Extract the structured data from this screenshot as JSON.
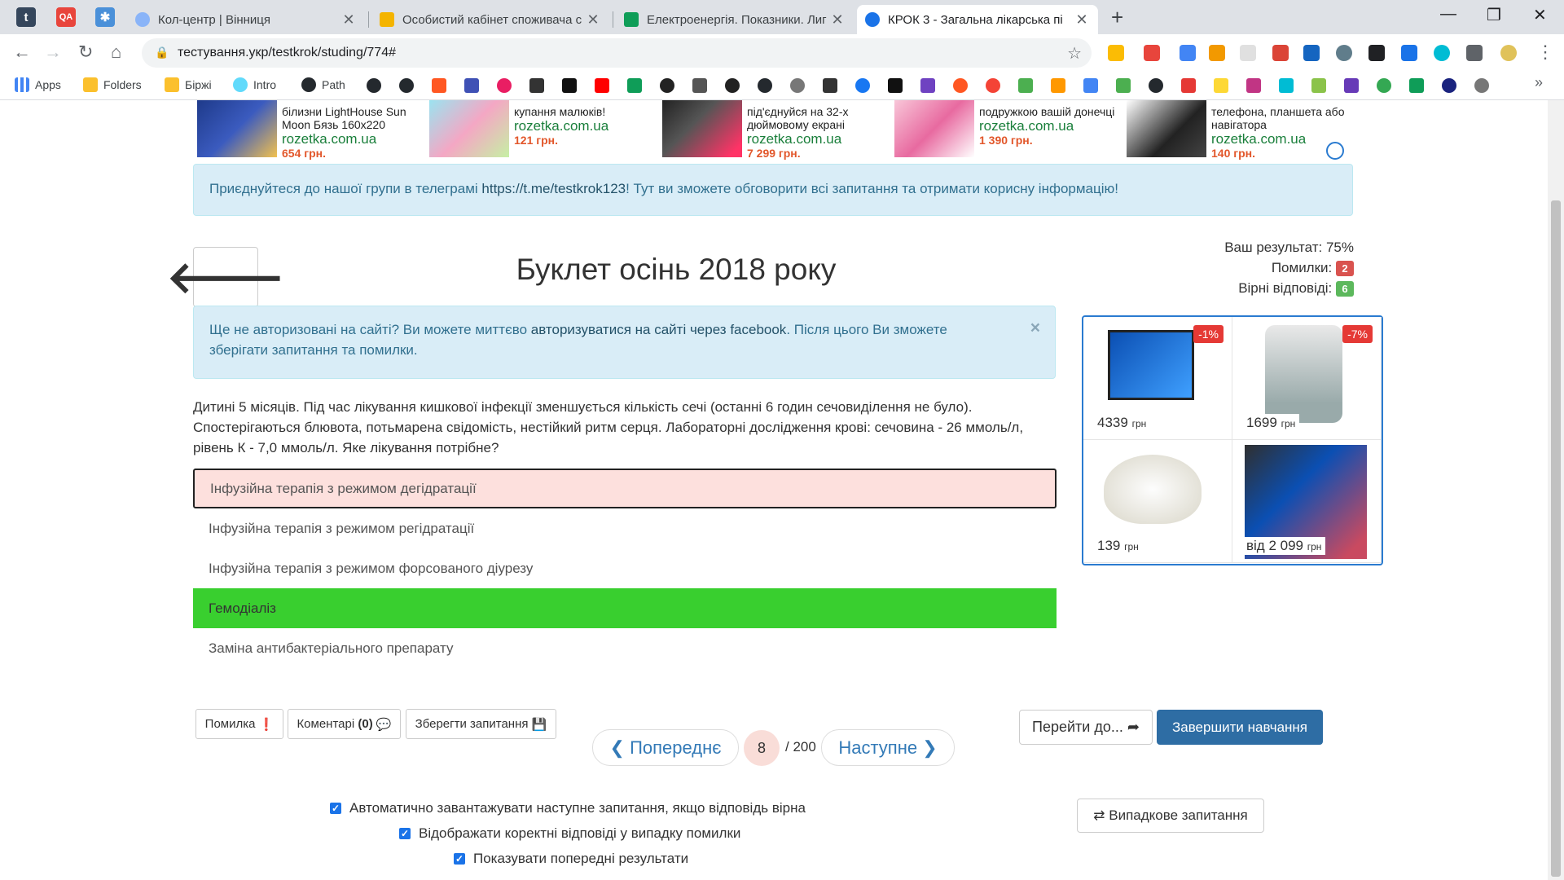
{
  "browser": {
    "tabs": [
      {
        "title": "Кол-центр | Вінниця"
      },
      {
        "title": "Особистий кабінет споживача с"
      },
      {
        "title": "Електроенергія. Показники. Лиг"
      },
      {
        "title": "КРОК 3 - Загальна лікарська пі"
      }
    ],
    "url": "тестування.укр/testkrok/studing/774#",
    "bookmarks": [
      "Apps",
      "Folders",
      "Біржі",
      "Intro",
      "Path"
    ]
  },
  "ads": [
    {
      "text": "білизни LightHouse Sun Moon Бязь 160x220",
      "site": "rozetka.com.ua",
      "price": "654 грн."
    },
    {
      "text": "купання малюків!",
      "site": "rozetka.com.ua",
      "price": "121 грн."
    },
    {
      "text": "під'єднуйся на 32-х дюймовому екрані",
      "site": "rozetka.com.ua",
      "price": "7 299 грн."
    },
    {
      "text": "подружкою вашій донечці",
      "site": "rozetka.com.ua",
      "price": "1 390 грн."
    },
    {
      "text": "телефона, планшета або навігатора",
      "site": "rozetka.com.ua",
      "price": "140 грн."
    }
  ],
  "telegram_alert": {
    "before": "Приєднуйтеся до нашої групи в телеграмі ",
    "link": "https://t.me/testkrok123",
    "after": "! Тут ви зможете обговорити всі запитання та отримати корисну інформацію!"
  },
  "title": "Буклет осінь 2018 року",
  "stats": {
    "result_label": "Ваш результат: 75%",
    "errors_label": "Помилки:",
    "errors_count": "2",
    "correct_label": "Вірні відповіді:",
    "correct_count": "6"
  },
  "login_alert": {
    "before": "Ще не авторизовані на сайті? Ви можете миттєво ",
    "link": "авторизуватися на сайті через facebook",
    "after": ". Після цього Ви зможете зберігати запитання та помилки.",
    "close": "×"
  },
  "question": "Дитині 5 місяців. Під час лікування кишкової інфекції зменшується кількість сечі (останні 6 годин сечовиділення не було). Спостерігаються блювота, потьмарена свідомість, нестійкий ритм серця. Лабораторні дослідження крові: сечовина - 26 ммоль/л, рівень К - 7,0 ммоль/л. Яке лікування потрібне?",
  "answers": [
    {
      "text": "Інфузійна терапія з режимом дегідратації",
      "state": "wrong"
    },
    {
      "text": "Інфузійна терапія з режимом регідратації",
      "state": "none"
    },
    {
      "text": "Інфузійна терапія з режимом форсованого діурезу",
      "state": "none"
    },
    {
      "text": "Гемодіаліз",
      "state": "correct"
    },
    {
      "text": "Заміна антибактеріального препарату",
      "state": "none"
    }
  ],
  "promo": [
    {
      "price": "4339",
      "unit": "грн",
      "discount": "-1%"
    },
    {
      "price": "1699",
      "unit": "грн",
      "discount": "-7%"
    },
    {
      "price": "139",
      "unit": "грн",
      "discount": ""
    },
    {
      "price": "від 2 099",
      "unit": "грн",
      "discount": ""
    }
  ],
  "actions": {
    "error_btn": "Помилка",
    "comments_btn": "Коментарі",
    "comments_count": "(0)",
    "save_btn": "Зберегти запитання"
  },
  "pager": {
    "prev": "Попереднє",
    "current": "8",
    "total": "/ 200",
    "next": "Наступне"
  },
  "goto_btn": "Перейти до...",
  "finish_btn": "Завершити навчання",
  "random_btn": "Випадкове запитання",
  "options": [
    "Автоматично завантажувати наступне запитання, якщо відповідь вірна",
    "Відображати коректні відповіді у випадку помилки",
    "Показувати попередні результати"
  ]
}
